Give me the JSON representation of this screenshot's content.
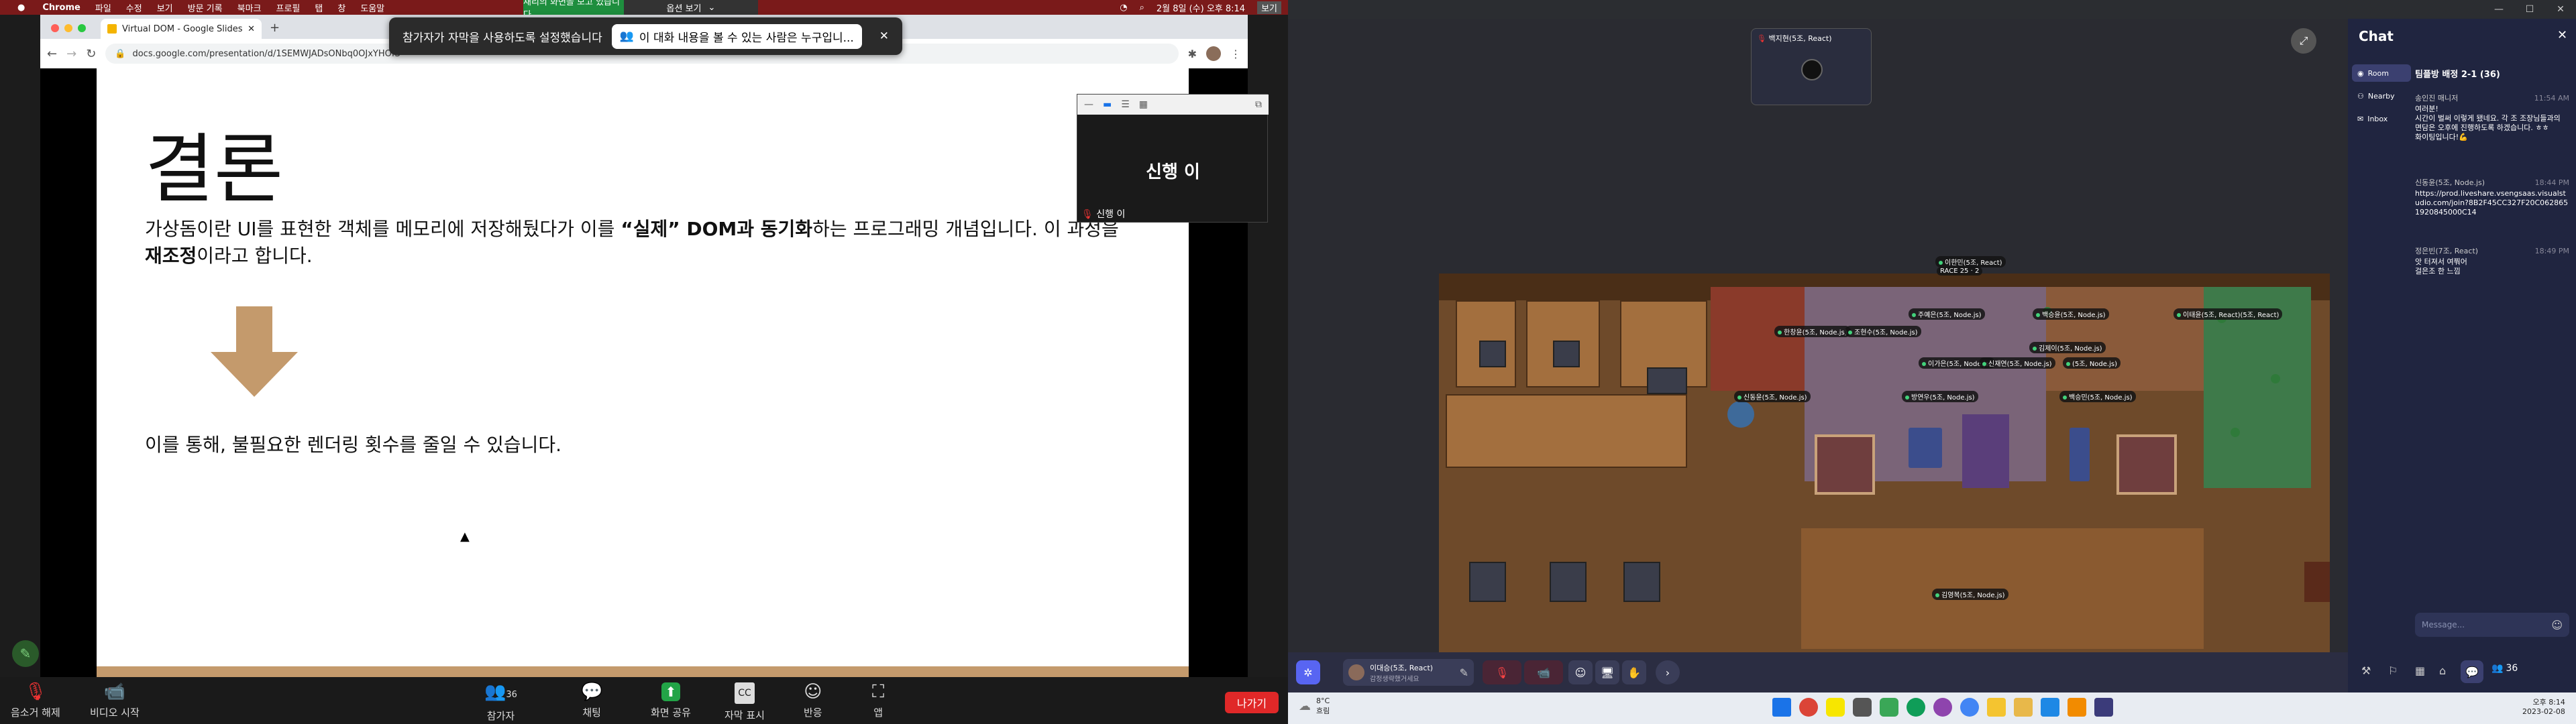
{
  "mac": {
    "menu": [
      "Chrome",
      "파일",
      "수정",
      "보기",
      "방문 기록",
      "북마크",
      "프로필",
      "탭",
      "창",
      "도움말"
    ],
    "datetime": "2월 8일 (수) 오후 8:14",
    "view_label": "보기"
  },
  "zoom_share": {
    "banner": "재리의 화면을 보고 있습니다",
    "options": "옵션 보기",
    "notification": {
      "text": "참가자가 자막을 사용하도록 설정했습니다",
      "pill": "이 대화 내용을 볼 수 있는 사람은 누구입니..."
    }
  },
  "chrome": {
    "tab_title": "Virtual DOM - Google Slides",
    "url": "docs.google.com/presentation/d/1SEMWJADsONbq0OJxYHOfS"
  },
  "slide": {
    "title": "결론",
    "p1_a": "가상돔이란 UI를 표현한 객체를 메모리에 저장해뒀다가 이를 ",
    "p1_b": "“실제” DOM과 동기화",
    "p1_c": "하는 프로그래밍 개념입니다. 이 과정을 ",
    "p1_d": "재조정",
    "p1_e": "이라고 합니다.",
    "p2": "이를 통해, 불필요한 렌더링 횟수를 줄일 수 있습니다."
  },
  "thumbnail": {
    "name": "신행 이",
    "label": "신행 이"
  },
  "zoom_bar": {
    "audio": "음소거 해제",
    "video": "비디오 시작",
    "participants": "참가자",
    "participants_count": "36",
    "chat": "채팅",
    "share": "화면 공유",
    "captions": "자막 표시",
    "reactions": "반응",
    "apps": "앱",
    "leave": "나가기"
  },
  "gather": {
    "video_tile_name": "백지현(5조, React)",
    "chat_title": "Chat",
    "sidebar": {
      "room": "Room",
      "nearby": "Nearby",
      "inbox": "Inbox"
    },
    "room_name": "팀플방 배정 2-1 (36)",
    "messages": [
      {
        "sender": "송인진 매니저",
        "time": "11:54 AM",
        "text": "여러분!\n시간이 벌써 이렇게 됐네요. 각 조 조장님들과의 면담은 오후에 진행하도록 하겠습니다. ㅎㅎ\n화이팅입니다!💪"
      },
      {
        "sender": "신동윤(5조, Node.js)",
        "time": "18:44 PM",
        "text": "https://prod.liveshare.vsengsaas.visualstudio.com/join?8B2F45CC327F20C0628651920845000C14"
      },
      {
        "sender": "정은빈(7조, React)",
        "time": "18:49 PM",
        "text": "앗 터져서 여쭤어\n걸은조 한 느낌"
      }
    ],
    "message_placeholder": "Message...",
    "player_name": "이대승(5조, React)",
    "player_status": "감정생략했거세요",
    "participant_count": "36",
    "map_tags": [
      "이한민(5조, React)",
      "주예은(5조, Node.js)",
      "백승윤(5조, Node.js)",
      "이태윤(5조, React)(5조, React)",
      "한창윤(5조, Node.js)",
      "조현수(5조, Node.js)",
      "김제이(5조, Node.js)",
      "이가은(5조, Node.js)",
      "신재연(5조, Node.js)",
      "(5조, Node.js)",
      "신동윤(5조, Node.js)",
      "방연우(5조, Node.js)",
      "백승민(5조, Node.js)",
      "김영복(5조, Node.js)"
    ],
    "floor_label": "RACE 25 · 2"
  },
  "taskbar": {
    "weather_temp": "8°C",
    "weather_text": "흐림",
    "time": "오후 8:14",
    "date": "2023-02-08"
  }
}
